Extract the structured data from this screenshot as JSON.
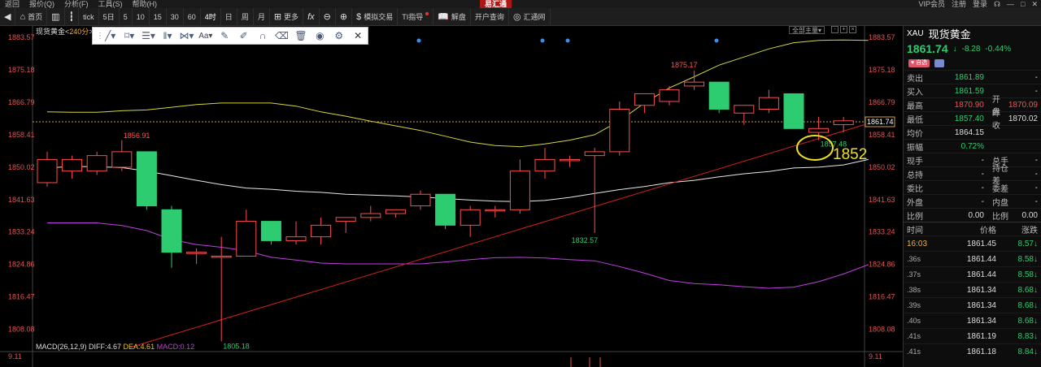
{
  "menubar": {
    "items": [
      "返回",
      "报价(Q)",
      "分析(F)",
      "工具(S)",
      "帮助(H)"
    ],
    "brand": "易汇通",
    "right": [
      "VIP会员",
      "注册",
      "登录"
    ]
  },
  "toolbar": {
    "home": "首页",
    "periods": [
      "tick",
      "5日",
      "5",
      "10",
      "15",
      "30",
      "60",
      "4时",
      "日",
      "周",
      "月"
    ],
    "more": "更多",
    "sim_trade": "模拟交易",
    "ti": "TI指导",
    "review": "解盘",
    "open_account": "开户查询",
    "huitong": "汇通网"
  },
  "chart": {
    "instrument": "现货黄金",
    "timeframe": "240分",
    "main_frame_label": "全部主量",
    "macd_label": "MACD(26,12,9)",
    "diff": "DIFF:4.67",
    "dea": "DEA:4.61",
    "macd": "MACD:0.12",
    "current_price_tag": "1861.74",
    "annotation": "1852",
    "macd_axis": "9.11"
  },
  "chart_data": {
    "type": "candlestick",
    "ylim": [
      1804.0,
      1884.0
    ],
    "y_ticks": [
      1883.57,
      1875.18,
      1866.79,
      1858.41,
      1850.02,
      1841.63,
      1833.24,
      1824.86,
      1816.47,
      1808.08
    ],
    "y_tick_labels": [
      "1883.57",
      "1875.18",
      "1866.79",
      "1858.41",
      "1850.02",
      "1841.63",
      "1833.24",
      "1824.86",
      "1816.47",
      "1808.08"
    ],
    "point_labels": [
      {
        "text": "1856.91",
        "i": 3,
        "value": 1856.91,
        "color": "#ff5555"
      },
      {
        "text": "1805.18",
        "i": 7,
        "value": 1805.18,
        "color": "#2ecc71"
      },
      {
        "text": "1832.57",
        "i": 21,
        "value": 1832.57,
        "color": "#2ecc71"
      },
      {
        "text": "1875.17",
        "i": 25,
        "value": 1875.17,
        "color": "#ff5555"
      },
      {
        "text": "1857.48",
        "i": 31,
        "value": 1857.48,
        "color": "#2ecc71"
      }
    ],
    "candles": [
      {
        "o": 1846,
        "h": 1854,
        "l": 1845,
        "c": 1852
      },
      {
        "o": 1849,
        "h": 1853,
        "l": 1847,
        "c": 1852
      },
      {
        "o": 1849,
        "h": 1854,
        "l": 1848,
        "c": 1853
      },
      {
        "o": 1850,
        "h": 1857,
        "l": 1849,
        "c": 1854
      },
      {
        "o": 1854,
        "h": 1854,
        "l": 1839,
        "c": 1840
      },
      {
        "o": 1839,
        "h": 1840,
        "l": 1824,
        "c": 1828
      },
      {
        "o": 1828,
        "h": 1829,
        "l": 1825,
        "c": 1828
      },
      {
        "o": 1827,
        "h": 1832,
        "l": 1805,
        "c": 1827
      },
      {
        "o": 1827,
        "h": 1839,
        "l": 1827,
        "c": 1836
      },
      {
        "o": 1836,
        "h": 1836,
        "l": 1830,
        "c": 1831
      },
      {
        "o": 1831,
        "h": 1836,
        "l": 1830,
        "c": 1832
      },
      {
        "o": 1832,
        "h": 1837,
        "l": 1830,
        "c": 1835
      },
      {
        "o": 1836,
        "h": 1837,
        "l": 1833,
        "c": 1837
      },
      {
        "o": 1837,
        "h": 1840,
        "l": 1836,
        "c": 1838
      },
      {
        "o": 1838,
        "h": 1839,
        "l": 1837,
        "c": 1839
      },
      {
        "o": 1840,
        "h": 1844,
        "l": 1839,
        "c": 1843
      },
      {
        "o": 1843,
        "h": 1843,
        "l": 1834,
        "c": 1835
      },
      {
        "o": 1835,
        "h": 1840,
        "l": 1832,
        "c": 1839
      },
      {
        "o": 1839,
        "h": 1840,
        "l": 1837,
        "c": 1839
      },
      {
        "o": 1839,
        "h": 1852,
        "l": 1838,
        "c": 1849
      },
      {
        "o": 1849,
        "h": 1855,
        "l": 1847,
        "c": 1852
      },
      {
        "o": 1852,
        "h": 1853,
        "l": 1850,
        "c": 1852
      },
      {
        "o": 1853,
        "h": 1855,
        "l": 1833,
        "c": 1854
      },
      {
        "o": 1854,
        "h": 1867,
        "l": 1853,
        "c": 1865
      },
      {
        "o": 1866,
        "h": 1869,
        "l": 1864,
        "c": 1869
      },
      {
        "o": 1867,
        "h": 1871,
        "l": 1866,
        "c": 1870
      },
      {
        "o": 1871,
        "h": 1875,
        "l": 1870,
        "c": 1872
      },
      {
        "o": 1872,
        "h": 1872,
        "l": 1864,
        "c": 1865
      },
      {
        "o": 1864,
        "h": 1865,
        "l": 1861,
        "c": 1866
      },
      {
        "o": 1865,
        "h": 1870,
        "l": 1864,
        "c": 1868
      },
      {
        "o": 1869,
        "h": 1869,
        "l": 1860,
        "c": 1860
      },
      {
        "o": 1859,
        "h": 1863,
        "l": 1857,
        "c": 1860
      },
      {
        "o": 1861,
        "h": 1863,
        "l": 1859,
        "c": 1862
      }
    ],
    "upper_band": [
      1864.3,
      1864.2,
      1864.2,
      1864.6,
      1864.8,
      1865.5,
      1866.2,
      1866.6,
      1866.6,
      1866.6,
      1865.8,
      1864.3,
      1863.2,
      1861.9,
      1860.7,
      1859.5,
      1858.0,
      1856.5,
      1855.6,
      1855.3,
      1856.0,
      1857.0,
      1858.4,
      1862.0,
      1866.6,
      1870.5,
      1873.4,
      1876.4,
      1878.5,
      1880.6,
      1882.2,
      1882.8,
      1882.9,
      1882.8
    ],
    "mid_band": [
      1849.8,
      1850.2,
      1850.1,
      1849.9,
      1849.0,
      1847.8,
      1846.6,
      1845.5,
      1844.6,
      1844.3,
      1843.8,
      1843.5,
      1843.0,
      1842.8,
      1842.6,
      1842.3,
      1841.9,
      1841.5,
      1841.2,
      1841.1,
      1841.4,
      1842.2,
      1843.2,
      1844.2,
      1845.0,
      1846.0,
      1846.6,
      1847.5,
      1848.3,
      1848.9,
      1849.8,
      1850.0,
      1850.6,
      1852.0
    ],
    "lower_band": [
      1835.6,
      1835.6,
      1835.6,
      1834.9,
      1833.6,
      1831.3,
      1830.0,
      1829.3,
      1828.4,
      1826.7,
      1826.0,
      1825.2,
      1825.0,
      1825.0,
      1825.0,
      1825.0,
      1825.5,
      1826.1,
      1826.6,
      1826.7,
      1826.5,
      1826.1,
      1825.8,
      1824.3,
      1822.6,
      1820.7,
      1819.9,
      1819.6,
      1819.1,
      1818.7,
      1819.0,
      1820.4,
      1822.4,
      1824.8
    ]
  },
  "quote": {
    "code": "XAU",
    "name": "现货黄金",
    "price": "1861.74",
    "arrow": "↓",
    "change": "-8.28",
    "change_pct": "-0.44%",
    "tag": "自选",
    "rows": [
      {
        "l": "卖出",
        "v": "1861.89",
        "l2": "",
        "v2": "-",
        "vc": "green",
        "v2c": "white"
      },
      {
        "l": "买入",
        "v": "1861.59",
        "l2": "",
        "v2": "-",
        "vc": "green",
        "v2c": "white"
      },
      {
        "l": "最高",
        "v": "1870.90",
        "l2": "开盘",
        "v2": "1870.09",
        "vc": "red",
        "v2c": "red"
      },
      {
        "l": "最低",
        "v": "1857.40",
        "l2": "昨收",
        "v2": "1870.02",
        "vc": "green",
        "v2c": "white"
      },
      {
        "l": "均价",
        "v": "1864.15",
        "l2": "",
        "v2": "",
        "vc": "white",
        "v2c": "white"
      },
      {
        "l": "振幅",
        "v": "0.72%",
        "l2": "",
        "v2": "",
        "vc": "green",
        "v2c": "white"
      },
      {
        "l": "现手",
        "v": "-",
        "l2": "总手",
        "v2": "-",
        "vc": "white",
        "v2c": "white"
      },
      {
        "l": "总持",
        "v": "-",
        "l2": "持仓差",
        "v2": "-",
        "vc": "white",
        "v2c": "white"
      },
      {
        "l": "委比",
        "v": "-",
        "l2": "委差",
        "v2": "-",
        "vc": "white",
        "v2c": "white"
      },
      {
        "l": "外盘",
        "v": "-",
        "l2": "内盘",
        "v2": "-",
        "vc": "white",
        "v2c": "white"
      },
      {
        "l": "比例",
        "v": "0.00",
        "l2": "比例",
        "v2": "0.00",
        "vc": "white",
        "v2c": "white"
      }
    ],
    "trade_head": [
      "时间",
      "价格",
      "涨跌"
    ],
    "trades": [
      {
        "t": "16:03",
        "p": "1861.45",
        "c": "8.57"
      },
      {
        "t": ".36s",
        "p": "1861.44",
        "c": "8.58"
      },
      {
        "t": ".37s",
        "p": "1861.44",
        "c": "8.58"
      },
      {
        "t": ".38s",
        "p": "1861.34",
        "c": "8.68"
      },
      {
        "t": ".39s",
        "p": "1861.34",
        "c": "8.68"
      },
      {
        "t": ".40s",
        "p": "1861.34",
        "c": "8.68"
      },
      {
        "t": ".41s",
        "p": "1861.19",
        "c": "8.83"
      },
      {
        "t": ".41s",
        "p": "1861.18",
        "c": "8.84"
      }
    ]
  },
  "colors": {
    "up": "#ff4d4d",
    "down": "#2ecc71",
    "upper_band": "#d6d63a",
    "mid_band": "#e8e8e8",
    "lower_band": "#c040e0",
    "trendline": "#d42020",
    "annotation": "#f0e020"
  }
}
